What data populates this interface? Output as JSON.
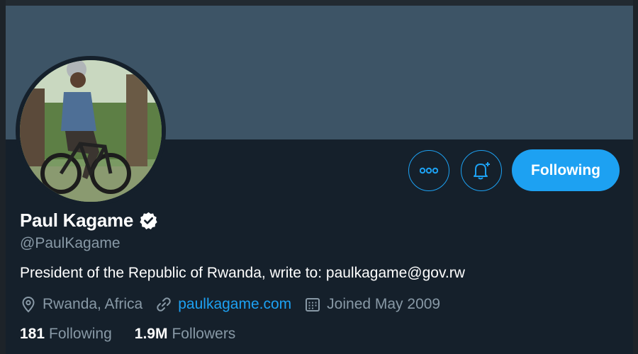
{
  "profile": {
    "name": "Paul Kagame",
    "handle": "@PaulKagame",
    "bio": "President of the Republic of Rwanda, write to: paulkagame@gov.rw",
    "location": "Rwanda, Africa",
    "website": "paulkagame.com",
    "joined": "Joined May 2009",
    "verified": true
  },
  "actions": {
    "follow_label": "Following",
    "more_icon": "more-options-icon",
    "notify_icon": "bell-plus-icon"
  },
  "stats": {
    "following_count": "181",
    "following_label": "Following",
    "followers_count": "1.9M",
    "followers_label": "Followers"
  },
  "colors": {
    "background": "#15202b",
    "banner": "#3d5466",
    "accent": "#1da1f2",
    "secondary_text": "#8899a6"
  },
  "icons": {
    "location": "location-pin-icon",
    "link": "link-icon",
    "calendar": "calendar-icon",
    "verified": "verified-badge-icon"
  }
}
